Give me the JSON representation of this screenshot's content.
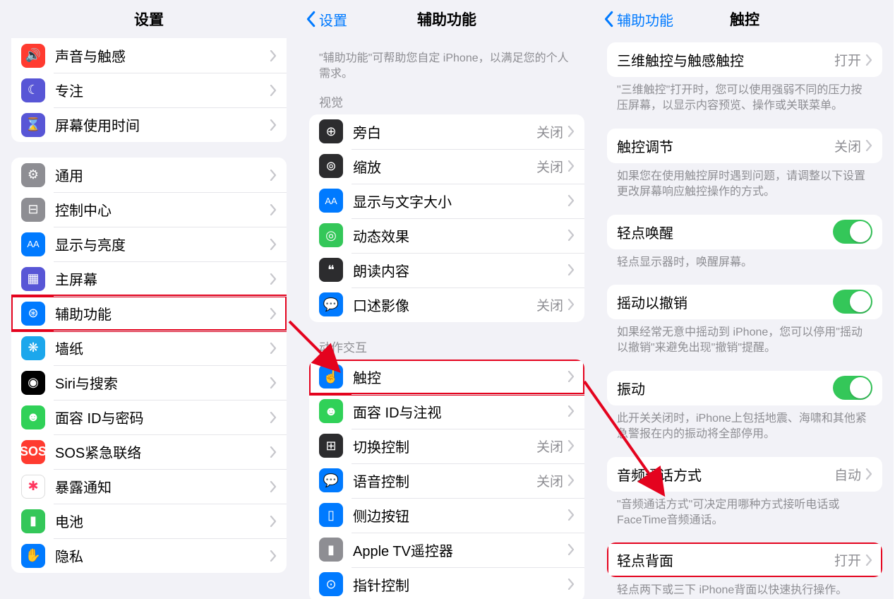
{
  "s1": {
    "title": "设置",
    "group1": [
      {
        "label": "声音与触感",
        "glyph": "🔊",
        "bg": "bg-red"
      },
      {
        "label": "专注",
        "glyph": "☾",
        "bg": "bg-indigo"
      },
      {
        "label": "屏幕使用时间",
        "glyph": "⌛",
        "bg": "bg-indigo"
      }
    ],
    "group2": [
      {
        "label": "通用",
        "glyph": "⚙",
        "bg": "bg-gray"
      },
      {
        "label": "控制中心",
        "glyph": "⊟",
        "bg": "bg-gray"
      },
      {
        "label": "显示与亮度",
        "glyph": "AA",
        "bg": "bg-blue",
        "fs": "13"
      },
      {
        "label": "主屏幕",
        "glyph": "▦",
        "bg": "bg-indigo"
      },
      {
        "label": "辅助功能",
        "glyph": "⊛",
        "bg": "bg-blue",
        "hl": true
      },
      {
        "label": "墙纸",
        "glyph": "❋",
        "bg": "bg-cyan"
      },
      {
        "label": "Siri与搜索",
        "glyph": "◉",
        "bg": "bg-black"
      },
      {
        "label": "面容 ID与密码",
        "glyph": "☻",
        "bg": "bg-faceid"
      },
      {
        "label": "SOS紧急联络",
        "glyph": "SOS",
        "bg": "bg-sos"
      },
      {
        "label": "暴露通知",
        "glyph": "✱",
        "bg": "bg-white",
        "color": "#ff375f"
      },
      {
        "label": "电池",
        "glyph": "▮",
        "bg": "bg-green"
      },
      {
        "label": "隐私",
        "glyph": "✋",
        "bg": "bg-blue"
      }
    ]
  },
  "s2": {
    "back": "设置",
    "title": "辅助功能",
    "intro": "\"辅助功能\"可帮助您自定 iPhone，以满足您的个人需求。",
    "sec1_label": "视觉",
    "sec1": [
      {
        "label": "旁白",
        "value": "关闭",
        "glyph": "⊕",
        "bg": "bg-darkgray"
      },
      {
        "label": "缩放",
        "value": "关闭",
        "glyph": "⊚",
        "bg": "bg-darkgray"
      },
      {
        "label": "显示与文字大小",
        "glyph": "AA",
        "bg": "bg-blue",
        "fs": "13"
      },
      {
        "label": "动态效果",
        "glyph": "◎",
        "bg": "bg-green"
      },
      {
        "label": "朗读内容",
        "glyph": "❝",
        "bg": "bg-darkgray"
      },
      {
        "label": "口述影像",
        "value": "关闭",
        "glyph": "💬",
        "bg": "bg-blue"
      }
    ],
    "sec2_label": "动作交互",
    "sec2": [
      {
        "label": "触控",
        "glyph": "☝",
        "bg": "bg-blue",
        "hl": true
      },
      {
        "label": "面容 ID与注视",
        "glyph": "☻",
        "bg": "bg-faceid"
      },
      {
        "label": "切换控制",
        "value": "关闭",
        "glyph": "⊞",
        "bg": "bg-darkgray"
      },
      {
        "label": "语音控制",
        "value": "关闭",
        "glyph": "💬",
        "bg": "bg-blue"
      },
      {
        "label": "侧边按钮",
        "glyph": "▯",
        "bg": "bg-blue"
      },
      {
        "label": "Apple TV遥控器",
        "glyph": "▮",
        "bg": "bg-gray"
      },
      {
        "label": "指针控制",
        "glyph": "⊙",
        "bg": "bg-blue"
      }
    ]
  },
  "s3": {
    "back": "辅助功能",
    "title": "触控",
    "rows": [
      {
        "type": "row",
        "label": "三维触控与触感触控",
        "value": "打开"
      },
      {
        "type": "note",
        "text": "\"三维触控\"打开时，您可以使用强弱不同的压力按压屏幕，以显示内容预览、操作或关联菜单。"
      },
      {
        "type": "row",
        "label": "触控调节",
        "value": "关闭"
      },
      {
        "type": "note",
        "text": "如果您在使用触控屏时遇到问题，请调整以下设置更改屏幕响应触控操作的方式。"
      },
      {
        "type": "toggle",
        "label": "轻点唤醒",
        "on": true
      },
      {
        "type": "note",
        "text": "轻点显示器时，唤醒屏幕。"
      },
      {
        "type": "toggle",
        "label": "摇动以撤销",
        "on": true
      },
      {
        "type": "note",
        "text": "如果经常无意中摇动到 iPhone，您可以停用\"摇动以撤销\"来避免出现\"撤销\"提醒。"
      },
      {
        "type": "toggle",
        "label": "振动",
        "on": true
      },
      {
        "type": "note",
        "text": "此开关关闭时，iPhone上包括地震、海啸和其他紧急警报在内的振动将全部停用。"
      },
      {
        "type": "row",
        "label": "音频通话方式",
        "value": "自动"
      },
      {
        "type": "note",
        "text": "\"音频通话方式\"可决定用哪种方式接听电话或 FaceTime音频通话。"
      },
      {
        "type": "row",
        "label": "轻点背面",
        "value": "打开",
        "hl": true
      },
      {
        "type": "note",
        "text": "轻点两下或三下 iPhone背面以快速执行操作。"
      }
    ]
  }
}
